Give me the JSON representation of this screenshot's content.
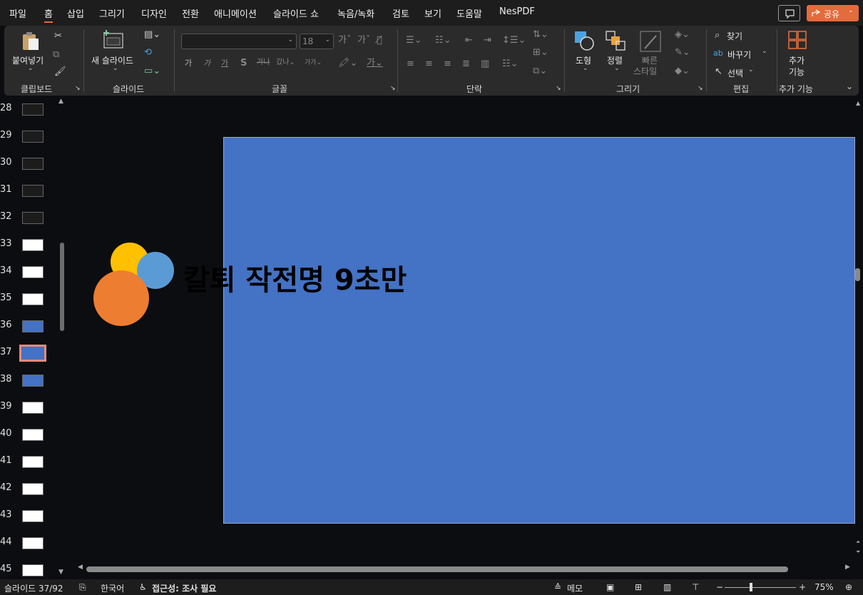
{
  "menu": {
    "tabs": [
      "파일",
      "홈",
      "삽입",
      "그리기",
      "디자인",
      "전환",
      "애니메이션",
      "슬라이드 쇼",
      "녹음/녹화",
      "검토",
      "보기",
      "도움말",
      "NesPDF"
    ],
    "share_label": "공유"
  },
  "ribbon": {
    "clipboard": {
      "paste_label": "붙여넣기",
      "group_label": "클립보드"
    },
    "slides": {
      "new_slide_label": "새 슬라이드",
      "group_label": "슬라이드"
    },
    "font": {
      "size_value": "18",
      "group_label": "글꼴"
    },
    "paragraph": {
      "group_label": "단락"
    },
    "drawing": {
      "shapes_label": "도형",
      "arrange_label": "정렬",
      "quick_styles_line1": "빠른",
      "quick_styles_line2": "스타일",
      "group_label": "그리기"
    },
    "editing": {
      "find_label": "찾기",
      "replace_label": "바꾸기",
      "select_label": "선택",
      "group_label": "편집"
    },
    "addins": {
      "label_line1": "추가",
      "label_line2": "기능",
      "group_label": "추가 기능"
    }
  },
  "thumbnails": [
    {
      "num": "28"
    },
    {
      "num": "29"
    },
    {
      "num": "30"
    },
    {
      "num": "31"
    },
    {
      "num": "32"
    },
    {
      "num": "33"
    },
    {
      "num": "34"
    },
    {
      "num": "35"
    },
    {
      "num": "36"
    },
    {
      "num": "37"
    },
    {
      "num": "38"
    },
    {
      "num": "39"
    },
    {
      "num": "40"
    },
    {
      "num": "41"
    },
    {
      "num": "42"
    },
    {
      "num": "43"
    },
    {
      "num": "44"
    },
    {
      "num": "45"
    }
  ],
  "selected_slide": "37",
  "slide": {
    "title": "칼퇴 작전명 9초만",
    "background_color": "#4472c4",
    "logo_colors": [
      "#ffc000",
      "#5b9bd5",
      "#ed7d31"
    ]
  },
  "status": {
    "slide_indicator": "슬라이드 37/92",
    "language": "한국어",
    "accessibility": "접근성: 조사 필요",
    "notes_label": "메모",
    "zoom": "75%"
  },
  "colors": {
    "accent": "#e36b3c"
  }
}
